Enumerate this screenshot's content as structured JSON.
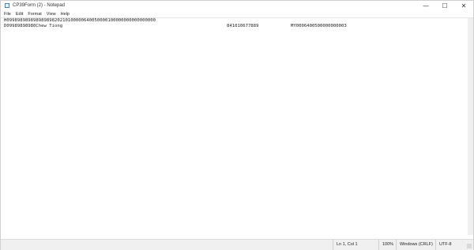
{
  "window": {
    "title": "CP39Form (2) - Notepad",
    "minimize_glyph": "—",
    "maximize_glyph": "☐",
    "close_glyph": "✕"
  },
  "menu": {
    "items": [
      "File",
      "Edit",
      "Format",
      "View",
      "Help"
    ]
  },
  "editor": {
    "line1": "H09989898989898989820210100000640050000100000000000000000",
    "line2": {
      "name_part": "D09989898980Chew Tiong",
      "number_part": "841010677889",
      "code_part": "MY0006400500000000003"
    }
  },
  "status": {
    "position": "Ln 1, Col 1",
    "zoom": "100%",
    "line_endings": "Windows (CRLF)",
    "encoding": "UTF-8"
  }
}
